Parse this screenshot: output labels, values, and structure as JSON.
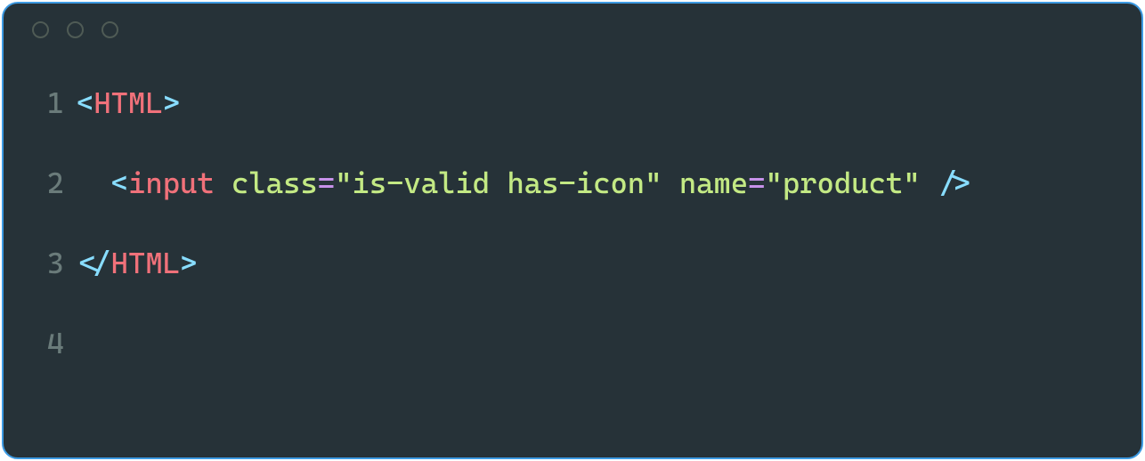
{
  "lines": [
    {
      "number": "1"
    },
    {
      "number": "2"
    },
    {
      "number": "3"
    },
    {
      "number": "4"
    }
  ],
  "code": {
    "line1": {
      "open": "<",
      "tag": "HTML",
      "close": ">"
    },
    "line2": {
      "indent": "  ",
      "open": "<",
      "tag": "input",
      "sp1": " ",
      "attr1": "class",
      "eq1": "=",
      "val1": "\"is-valid has-icon\"",
      "sp2": " ",
      "attr2": "name",
      "eq2": "=",
      "val2": "\"product\"",
      "sp3": " ",
      "selfclose": "/>"
    },
    "line3": {
      "open": "</",
      "tag": "HTML",
      "close": ">"
    }
  }
}
